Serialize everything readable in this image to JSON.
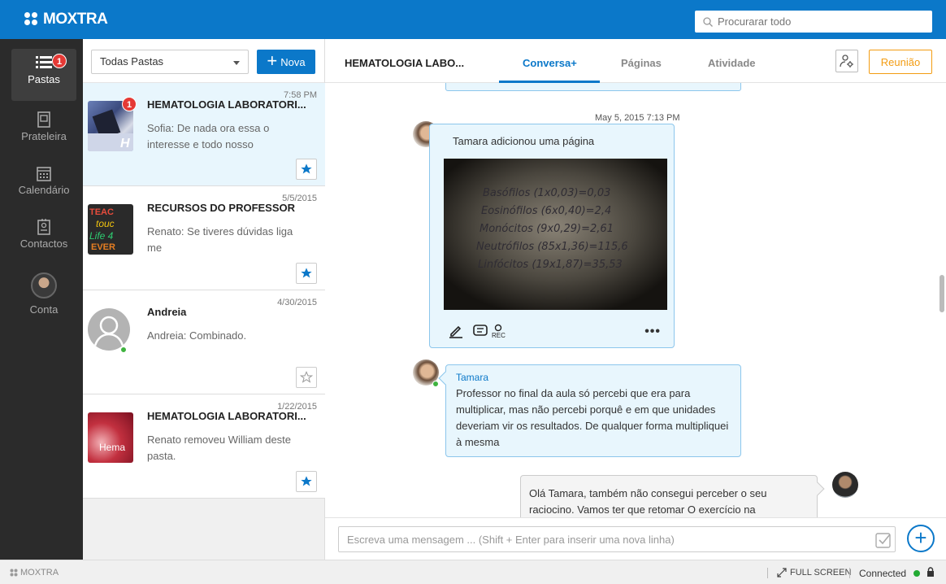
{
  "brand": {
    "name": "MOXTRA",
    "accent": "#0b78c9"
  },
  "search": {
    "placeholder": "Procurarar todo"
  },
  "nav": {
    "items": [
      {
        "label": "Pastas",
        "icon": "list-icon",
        "badge": "1"
      },
      {
        "label": "Prateleira",
        "icon": "shelf-icon"
      },
      {
        "label": "Calendário",
        "icon": "calendar-icon"
      },
      {
        "label": "Contactos",
        "icon": "contacts-icon"
      },
      {
        "label": "Conta",
        "icon": "avatar"
      }
    ]
  },
  "folders": {
    "filter": "Todas Pastas",
    "new_label": "Nova",
    "cards": [
      {
        "time": "7:58 PM",
        "title": "HEMATOLOGIA LABORATORI...",
        "message": "Sofia: De nada ora essa o interesse e todo nosso",
        "badge": "1",
        "starred": true
      },
      {
        "time": "5/5/2015",
        "title": "RECURSOS DO PROFESSOR",
        "message": "Renato: Se tiveres dúvidas liga me",
        "starred": true
      },
      {
        "time": "4/30/2015",
        "title": "Andreia",
        "message": "Andreia: Combinado.",
        "starred": false
      },
      {
        "time": "1/22/2015",
        "title": "HEMATOLOGIA LABORATORI...",
        "message": "Renato removeu William deste pasta.",
        "starred": true
      }
    ]
  },
  "main": {
    "title": "HEMATOLOGIA LABO...",
    "tabs": [
      "Conversa+",
      "Páginas",
      "Atividade"
    ],
    "meeting_label": "Reunião"
  },
  "chat": {
    "date": "May 5, 2015 7:13 PM",
    "page_event": "Tamara adicionou uma página",
    "handwriting": [
      "Basófilos (1x0,03)=0,03",
      "Eosinófilos (6x0,40)=2,4",
      "Monócitos (9x0,29)=2,61",
      "Neutrófilos (85x1,36)=115,6",
      "Linfócitos (19x1,87)=35,53"
    ],
    "rec_label": "REC",
    "message_name": "Tamara",
    "message_text": "Professor no final da aula só percebi que era para multiplicar, mas não percebi porquê e em que unidades deveriam vir os resultados. De qualquer forma multipliquei à mesma",
    "own_message": "Olá Tamara, também não consegui perceber o seu raciocino. Vamos ter que retomar O exercício na",
    "composer_placeholder": "Escreva uma mensagem ... (Shift + Enter para inserir uma nova linha)"
  },
  "footer": {
    "logo": "MOXTRA",
    "fullscreen": "FULL SCREEN",
    "status": "Connected"
  }
}
